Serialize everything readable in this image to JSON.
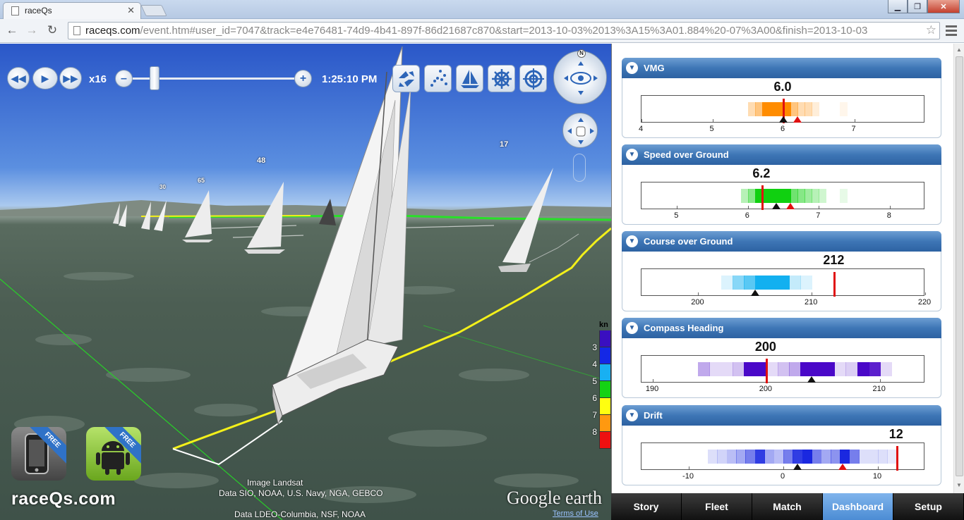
{
  "browser": {
    "tab_title": "raceQs",
    "url_host": "raceqs.com",
    "url_path": "/event.htm#user_id=7047&track=e4e76481-74d9-4b41-897f-86d21687c870&start=2013-10-03%2013%3A15%3A01.884%20-07%3A00&finish=2013-10-03"
  },
  "playback": {
    "speed": "x16",
    "time": "1:25:10 PM",
    "minus": "–",
    "plus": "+",
    "progress": 0.14
  },
  "tools": {
    "compass_north": "N"
  },
  "boat_labels": [
    {
      "text": "48",
      "id": "a"
    },
    {
      "text": "17",
      "id": "b"
    },
    {
      "text": "65",
      "id": "c"
    },
    {
      "text": "30",
      "id": "d"
    }
  ],
  "legend": {
    "unit": "kn",
    "entries": [
      {
        "value": "3",
        "color": "#3a0fc0"
      },
      {
        "value": "4",
        "color": "#1428e6"
      },
      {
        "value": "5",
        "color": "#18b0f2"
      },
      {
        "value": "6",
        "color": "#14d214"
      },
      {
        "value": "7",
        "color": "#ffff10"
      },
      {
        "value": "8",
        "color": "#ff9910"
      },
      {
        "value": "",
        "color": "#ee1010"
      }
    ]
  },
  "badges": {
    "free1": "FREE",
    "free2": "FREE"
  },
  "logo": "raceQs.com",
  "attribution": {
    "line1": "Image Landsat",
    "line2": "Data SIO, NOAA, U.S. Navy, NGA, GEBCO",
    "line3": "Data LDEO-Columbia, NSF, NOAA",
    "google_earth": "Google earth",
    "terms": "Terms of Use"
  },
  "dashboard": {
    "panels": [
      {
        "title": "VMG",
        "value": "6.0",
        "min": 4,
        "max": 8,
        "ticks": [
          "4",
          "5",
          "6",
          "7"
        ],
        "current": 6.0,
        "avg": 6.0,
        "target": 6.2,
        "color": "#ff8c00",
        "bins": [
          [
            5.5,
            0.3
          ],
          [
            5.6,
            0.5
          ],
          [
            5.7,
            1
          ],
          [
            5.8,
            1
          ],
          [
            5.9,
            1
          ],
          [
            6.0,
            1
          ],
          [
            6.1,
            0.5
          ],
          [
            6.2,
            0.3
          ],
          [
            6.3,
            0.3
          ],
          [
            6.4,
            0.15
          ],
          [
            6.8,
            0.08
          ]
        ]
      },
      {
        "title": "Speed over Ground",
        "value": "6.2",
        "min": 4.5,
        "max": 8.5,
        "ticks": [
          "5",
          "6",
          "7",
          "8"
        ],
        "current": 6.2,
        "avg": 6.4,
        "target": 6.6,
        "color": "#10d010",
        "bins": [
          [
            5.9,
            0.3
          ],
          [
            6.0,
            0.5
          ],
          [
            6.1,
            1
          ],
          [
            6.2,
            1
          ],
          [
            6.3,
            1
          ],
          [
            6.4,
            1
          ],
          [
            6.5,
            1
          ],
          [
            6.6,
            0.6
          ],
          [
            6.7,
            0.5
          ],
          [
            6.8,
            0.4
          ],
          [
            6.9,
            0.3
          ],
          [
            7.0,
            0.2
          ],
          [
            7.3,
            0.1
          ]
        ]
      },
      {
        "title": "Course over Ground",
        "value": "212",
        "min": 195,
        "max": 220,
        "ticks": [
          "200",
          "210",
          "220"
        ],
        "current": 212,
        "avg": 205,
        "target": null,
        "color": "#12b0f0",
        "bins": [
          [
            202,
            0.15
          ],
          [
            203,
            0.5
          ],
          [
            204,
            0.7
          ],
          [
            205,
            1
          ],
          [
            206,
            1
          ],
          [
            207,
            1
          ],
          [
            208,
            0.25
          ],
          [
            209,
            0.15
          ]
        ]
      },
      {
        "title": "Compass Heading",
        "value": "200",
        "min": 189,
        "max": 214,
        "ticks": [
          "190",
          "200",
          "210"
        ],
        "current": 200,
        "avg": 204,
        "target": null,
        "color": "#4a08c8",
        "bins": [
          [
            194,
            0.35
          ],
          [
            195,
            0.15
          ],
          [
            196,
            0.15
          ],
          [
            197,
            0.25
          ],
          [
            198,
            1
          ],
          [
            199,
            1
          ],
          [
            200,
            0.15
          ],
          [
            201,
            0.25
          ],
          [
            202,
            0.35
          ],
          [
            203,
            1
          ],
          [
            204,
            1
          ],
          [
            205,
            1
          ],
          [
            206,
            0.15
          ],
          [
            207,
            0.2
          ],
          [
            208,
            1
          ],
          [
            209,
            0.9
          ],
          [
            210,
            0.15
          ]
        ]
      },
      {
        "title": "Drift",
        "value": "12",
        "min": -15,
        "max": 15,
        "ticks": [
          "-10",
          "0",
          "10"
        ],
        "current": 12,
        "avg": 1.5,
        "target": 6.3,
        "color": "#1a28e0",
        "bins": [
          [
            -8,
            0.15
          ],
          [
            -7,
            0.2
          ],
          [
            -6,
            0.3
          ],
          [
            -5,
            0.4
          ],
          [
            -4,
            0.6
          ],
          [
            -3,
            0.9
          ],
          [
            -2,
            0.4
          ],
          [
            -1,
            0.3
          ],
          [
            0,
            0.6
          ],
          [
            1,
            0.9
          ],
          [
            2,
            1
          ],
          [
            3,
            0.6
          ],
          [
            4,
            0.4
          ],
          [
            5,
            0.5
          ],
          [
            6,
            1
          ],
          [
            7,
            0.6
          ],
          [
            8,
            0.15
          ],
          [
            9,
            0.15
          ],
          [
            10,
            0.15
          ],
          [
            11,
            0.1
          ]
        ]
      }
    ],
    "tabs": [
      {
        "label": "Story",
        "active": false
      },
      {
        "label": "Fleet",
        "active": false
      },
      {
        "label": "Match",
        "active": false
      },
      {
        "label": "Dashboard",
        "active": true
      },
      {
        "label": "Setup",
        "active": false
      }
    ]
  }
}
